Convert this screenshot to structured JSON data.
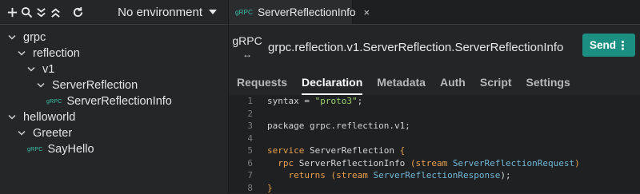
{
  "sidebar": {
    "environment": "No environment",
    "tree": [
      {
        "label": "grpc",
        "depth": 0,
        "type": "folder"
      },
      {
        "label": "reflection",
        "depth": 1,
        "type": "folder"
      },
      {
        "label": "v1",
        "depth": 2,
        "type": "folder"
      },
      {
        "label": "ServerReflection",
        "depth": 3,
        "type": "folder"
      },
      {
        "label": "ServerReflectionInfo",
        "depth": 4,
        "type": "grpc"
      },
      {
        "label": "helloworld",
        "depth": 0,
        "type": "folder"
      },
      {
        "label": "Greeter",
        "depth": 1,
        "type": "folder"
      },
      {
        "label": "SayHello",
        "depth": 2,
        "type": "grpc"
      }
    ],
    "grpc_badge": "gRPC"
  },
  "tab": {
    "badge": "gRPC",
    "label": "ServerReflectionInfo",
    "close": "×"
  },
  "request": {
    "protocol": "gRPC",
    "protocol_icon": "↔",
    "method": "grpc.reflection.v1.ServerReflection.ServerReflectionInfo",
    "send_label": "Send",
    "send_more": "⋮"
  },
  "subtabs": [
    "Requests",
    "Declaration",
    "Metadata",
    "Auth",
    "Script",
    "Settings"
  ],
  "active_subtab": "Declaration",
  "code": {
    "line_numbers": [
      "1",
      "2",
      "3",
      "4",
      "5",
      "6",
      "7",
      "8"
    ],
    "lines": [
      [
        {
          "t": "syntax = ",
          "c": ""
        },
        {
          "t": "\"proto3\"",
          "c": "str"
        },
        {
          "t": ";",
          "c": ""
        }
      ],
      [],
      [
        {
          "t": "package grpc.reflection.v1;",
          "c": ""
        }
      ],
      [],
      [
        {
          "t": "service ",
          "c": "kw"
        },
        {
          "t": "ServerReflection ",
          "c": ""
        },
        {
          "t": "{",
          "c": "kw"
        }
      ],
      [
        {
          "t": "  ",
          "c": ""
        },
        {
          "t": "rpc ",
          "c": "kw"
        },
        {
          "t": "ServerReflectionInfo ",
          "c": ""
        },
        {
          "t": "(stream ",
          "c": "kw"
        },
        {
          "t": "ServerReflectionRequest",
          "c": "ty"
        },
        {
          "t": ")",
          "c": "kw"
        }
      ],
      [
        {
          "t": "    ",
          "c": ""
        },
        {
          "t": "returns ",
          "c": "kw"
        },
        {
          "t": "(stream ",
          "c": "kw"
        },
        {
          "t": "ServerReflectionResponse",
          "c": "ty"
        },
        {
          "t": ");",
          "c": ""
        }
      ],
      [
        {
          "t": "}",
          "c": "kw"
        }
      ]
    ]
  },
  "colors": {
    "accent": "#1b8f82",
    "grpc": "#38c3aa"
  },
  "icons": {
    "toolbar": [
      "plus-icon",
      "search-icon",
      "collapse-all-icon",
      "expand-all-icon",
      "refresh-icon"
    ]
  }
}
